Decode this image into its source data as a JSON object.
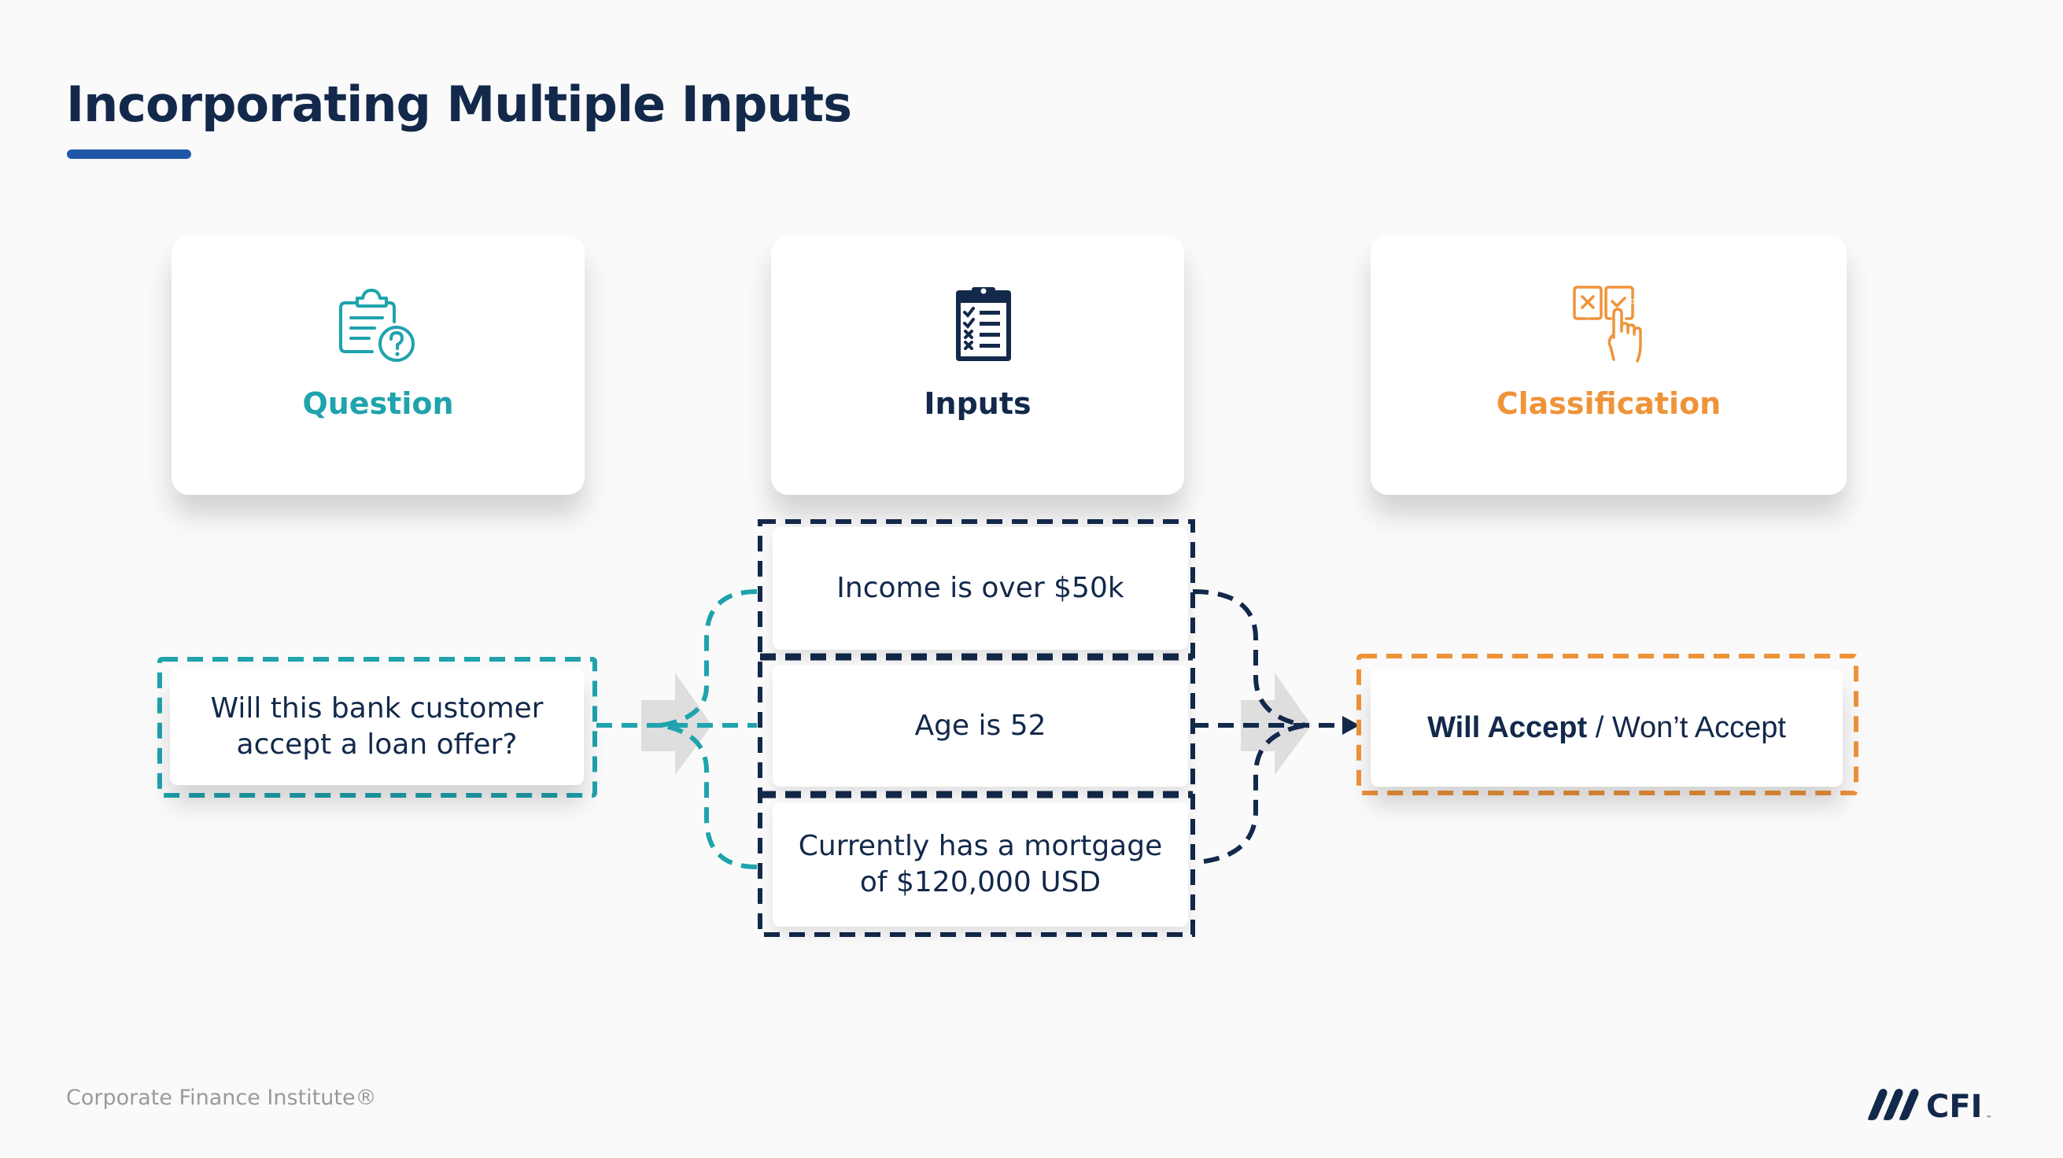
{
  "title": "Incorporating Multiple Inputs",
  "colors": {
    "navy": "#13294b",
    "teal": "#1fa3ad",
    "orange": "#ef9339",
    "accent_blue": "#2257a8",
    "arrow_gray": "#dedede"
  },
  "cards": [
    {
      "label": "Question",
      "icon": "clipboard-question-icon"
    },
    {
      "label": "Inputs",
      "icon": "clipboard-checklist-icon"
    },
    {
      "label": "Classification",
      "icon": "hand-select-checkbox-icon"
    }
  ],
  "question": {
    "line1": "Will this bank customer",
    "line2": "accept a loan offer?"
  },
  "inputs": [
    {
      "line1": "Income is over $50k",
      "line2": ""
    },
    {
      "line1": "Age is 52",
      "line2": ""
    },
    {
      "line1": "Currently has a mortgage",
      "line2": "of $120,000 USD"
    }
  ],
  "classification": {
    "bold": "Will Accept",
    "separator": " / ",
    "rest": "Won’t Accept"
  },
  "footer": {
    "brand": "Corporate Finance Institute®",
    "logo_text": "CFI",
    "logo_tm": "™"
  }
}
